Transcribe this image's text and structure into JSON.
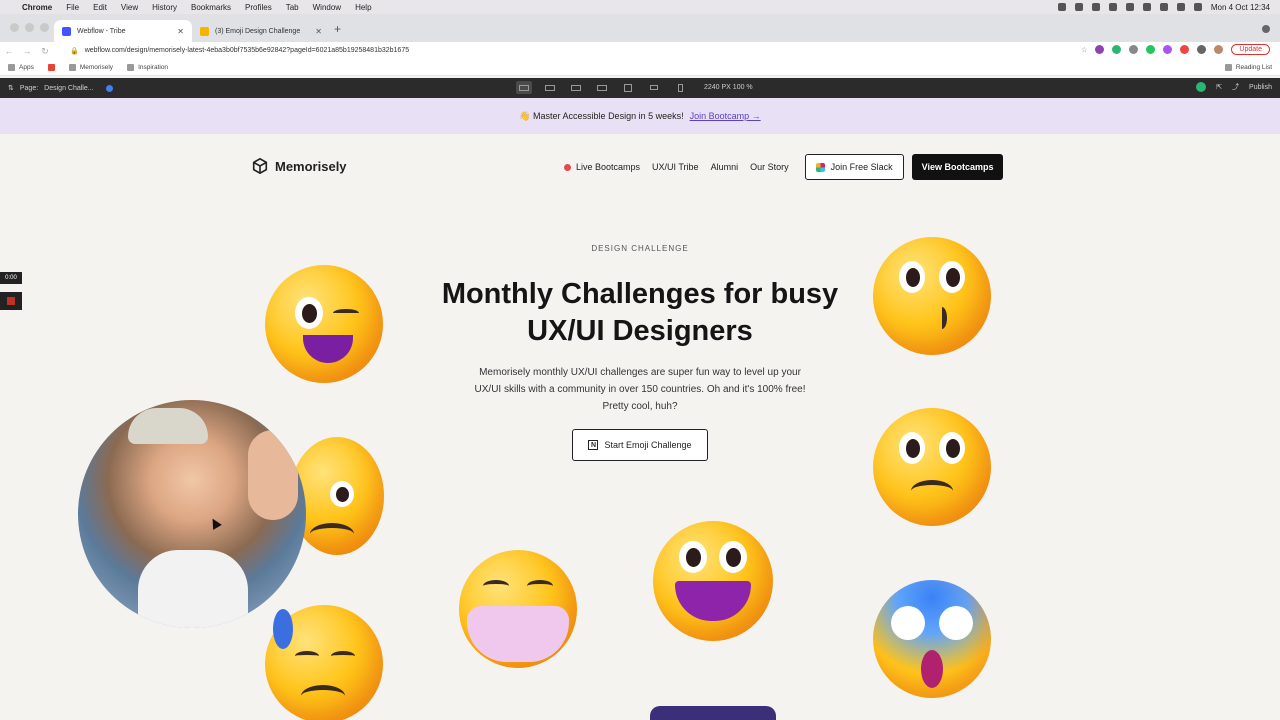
{
  "menubar": {
    "app": "Chrome",
    "items": [
      "File",
      "Edit",
      "View",
      "History",
      "Bookmarks",
      "Profiles",
      "Tab",
      "Window",
      "Help"
    ],
    "clock": "Mon 4 Oct  12:34"
  },
  "tabs": [
    {
      "title": "Webflow - Tribe",
      "favicon_color": "#4353ff",
      "active": true
    },
    {
      "title": "(3) Emoji Design Challenge",
      "favicon_color": "#f5b400",
      "active": false
    }
  ],
  "address": {
    "url": "webflow.com/design/memorisely-latest-4eba3b0bf7535b6e92842?pageId=6021a85b19258481b32b1675",
    "update_label": "Update"
  },
  "bookmarks": {
    "items": [
      "Apps",
      "",
      "Memorisely",
      "Inspiration"
    ],
    "reading_list": "Reading List"
  },
  "webflow": {
    "page_label": "Page:",
    "page_name": "Design Challe...",
    "size": "2240 PX  100 %",
    "publish": "Publish"
  },
  "site": {
    "banner": {
      "text": "👋 Master Accessible Design in 5 weeks!",
      "link": "Join Bootcamp →"
    },
    "logo": "Memorisely",
    "nav": {
      "live": "Live Bootcamps",
      "tribe": "UX/UI Tribe",
      "alumni": "Alumni",
      "story": "Our Story",
      "slack": "Join Free Slack",
      "bootcamps": "View Bootcamps"
    },
    "hero": {
      "eyebrow": "DESIGN CHALLENGE",
      "title": "Monthly Challenges for busy UX/UI Designers",
      "subtitle": "Memorisely monthly UX/UI challenges are super fun way to level up your UX/UI skills with a community in over 150 countries. Oh and it's 100% free! Pretty cool, huh?",
      "cta": "Start Emoji Challenge"
    }
  },
  "recorder": {
    "time": "0:00"
  },
  "colors": {
    "banner_bg": "#e8e0f4",
    "link": "#5b3fc4",
    "live_dot": "#e5484d",
    "page_bg": "#f5f3f0"
  }
}
